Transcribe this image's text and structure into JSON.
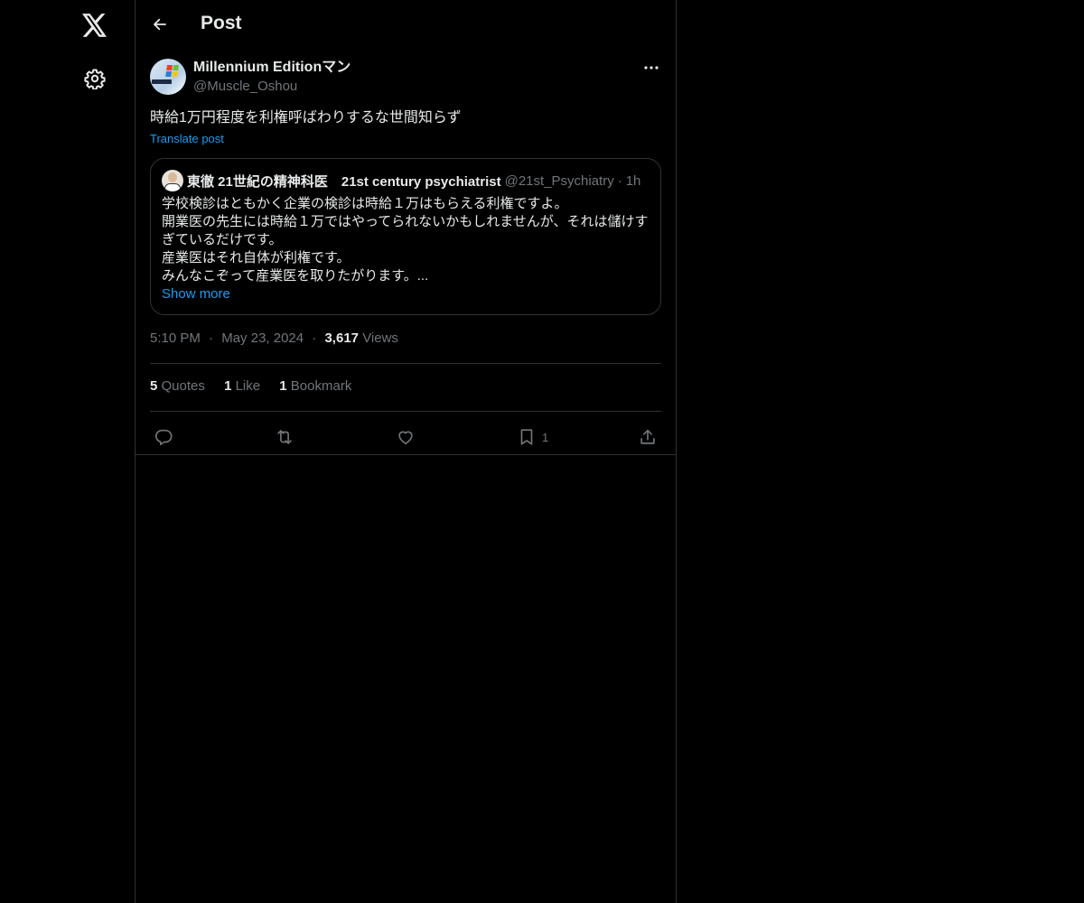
{
  "sidebar": {
    "logo_icon": "x-logo-icon",
    "settings_icon": "gear-icon"
  },
  "header": {
    "back_icon": "arrow-left-icon",
    "title": "Post"
  },
  "post": {
    "author": {
      "name": "Millennium Editionマン",
      "handle": "@Muscle_Oshou"
    },
    "text": "時給1万円程度を利権呼ばわりするな世間知らず",
    "translate_label": "Translate post",
    "quote": {
      "author": {
        "name": "東徹 21世紀の精神科医　21st century psychiatrist",
        "handle": "@21st_Psychiatry",
        "dot": "·",
        "time": "1h"
      },
      "lines": [
        "学校検診はともかく企業の検診は時給１万はもらえる利権ですよ。",
        "開業医の先生には時給１万ではやってられないかもしれませんが、それは儲けす",
        "ぎているだけです。",
        "産業医はそれ自体が利権です。",
        "みんなこぞって産業医を取りたがります。..."
      ],
      "show_more": "Show more"
    },
    "meta": {
      "time": "5:10 PM",
      "sep": "·",
      "date": "May 23, 2024",
      "views_count": "3,617",
      "views_label": "Views"
    },
    "stats": {
      "quotes_count": "5",
      "quotes_label": "Quotes",
      "likes_count": "1",
      "likes_label": "Like",
      "bookmarks_count": "1",
      "bookmarks_label": "Bookmark"
    },
    "actions": {
      "reply_icon": "reply-icon",
      "repost_icon": "repost-icon",
      "like_icon": "heart-icon",
      "bookmark_icon": "bookmark-icon",
      "bookmark_count": "1",
      "share_icon": "share-icon"
    }
  },
  "colors": {
    "background": "#000000",
    "text": "#e7e9ea",
    "muted": "#71767b",
    "accent": "#1d9bf0",
    "border": "#2f3336"
  }
}
